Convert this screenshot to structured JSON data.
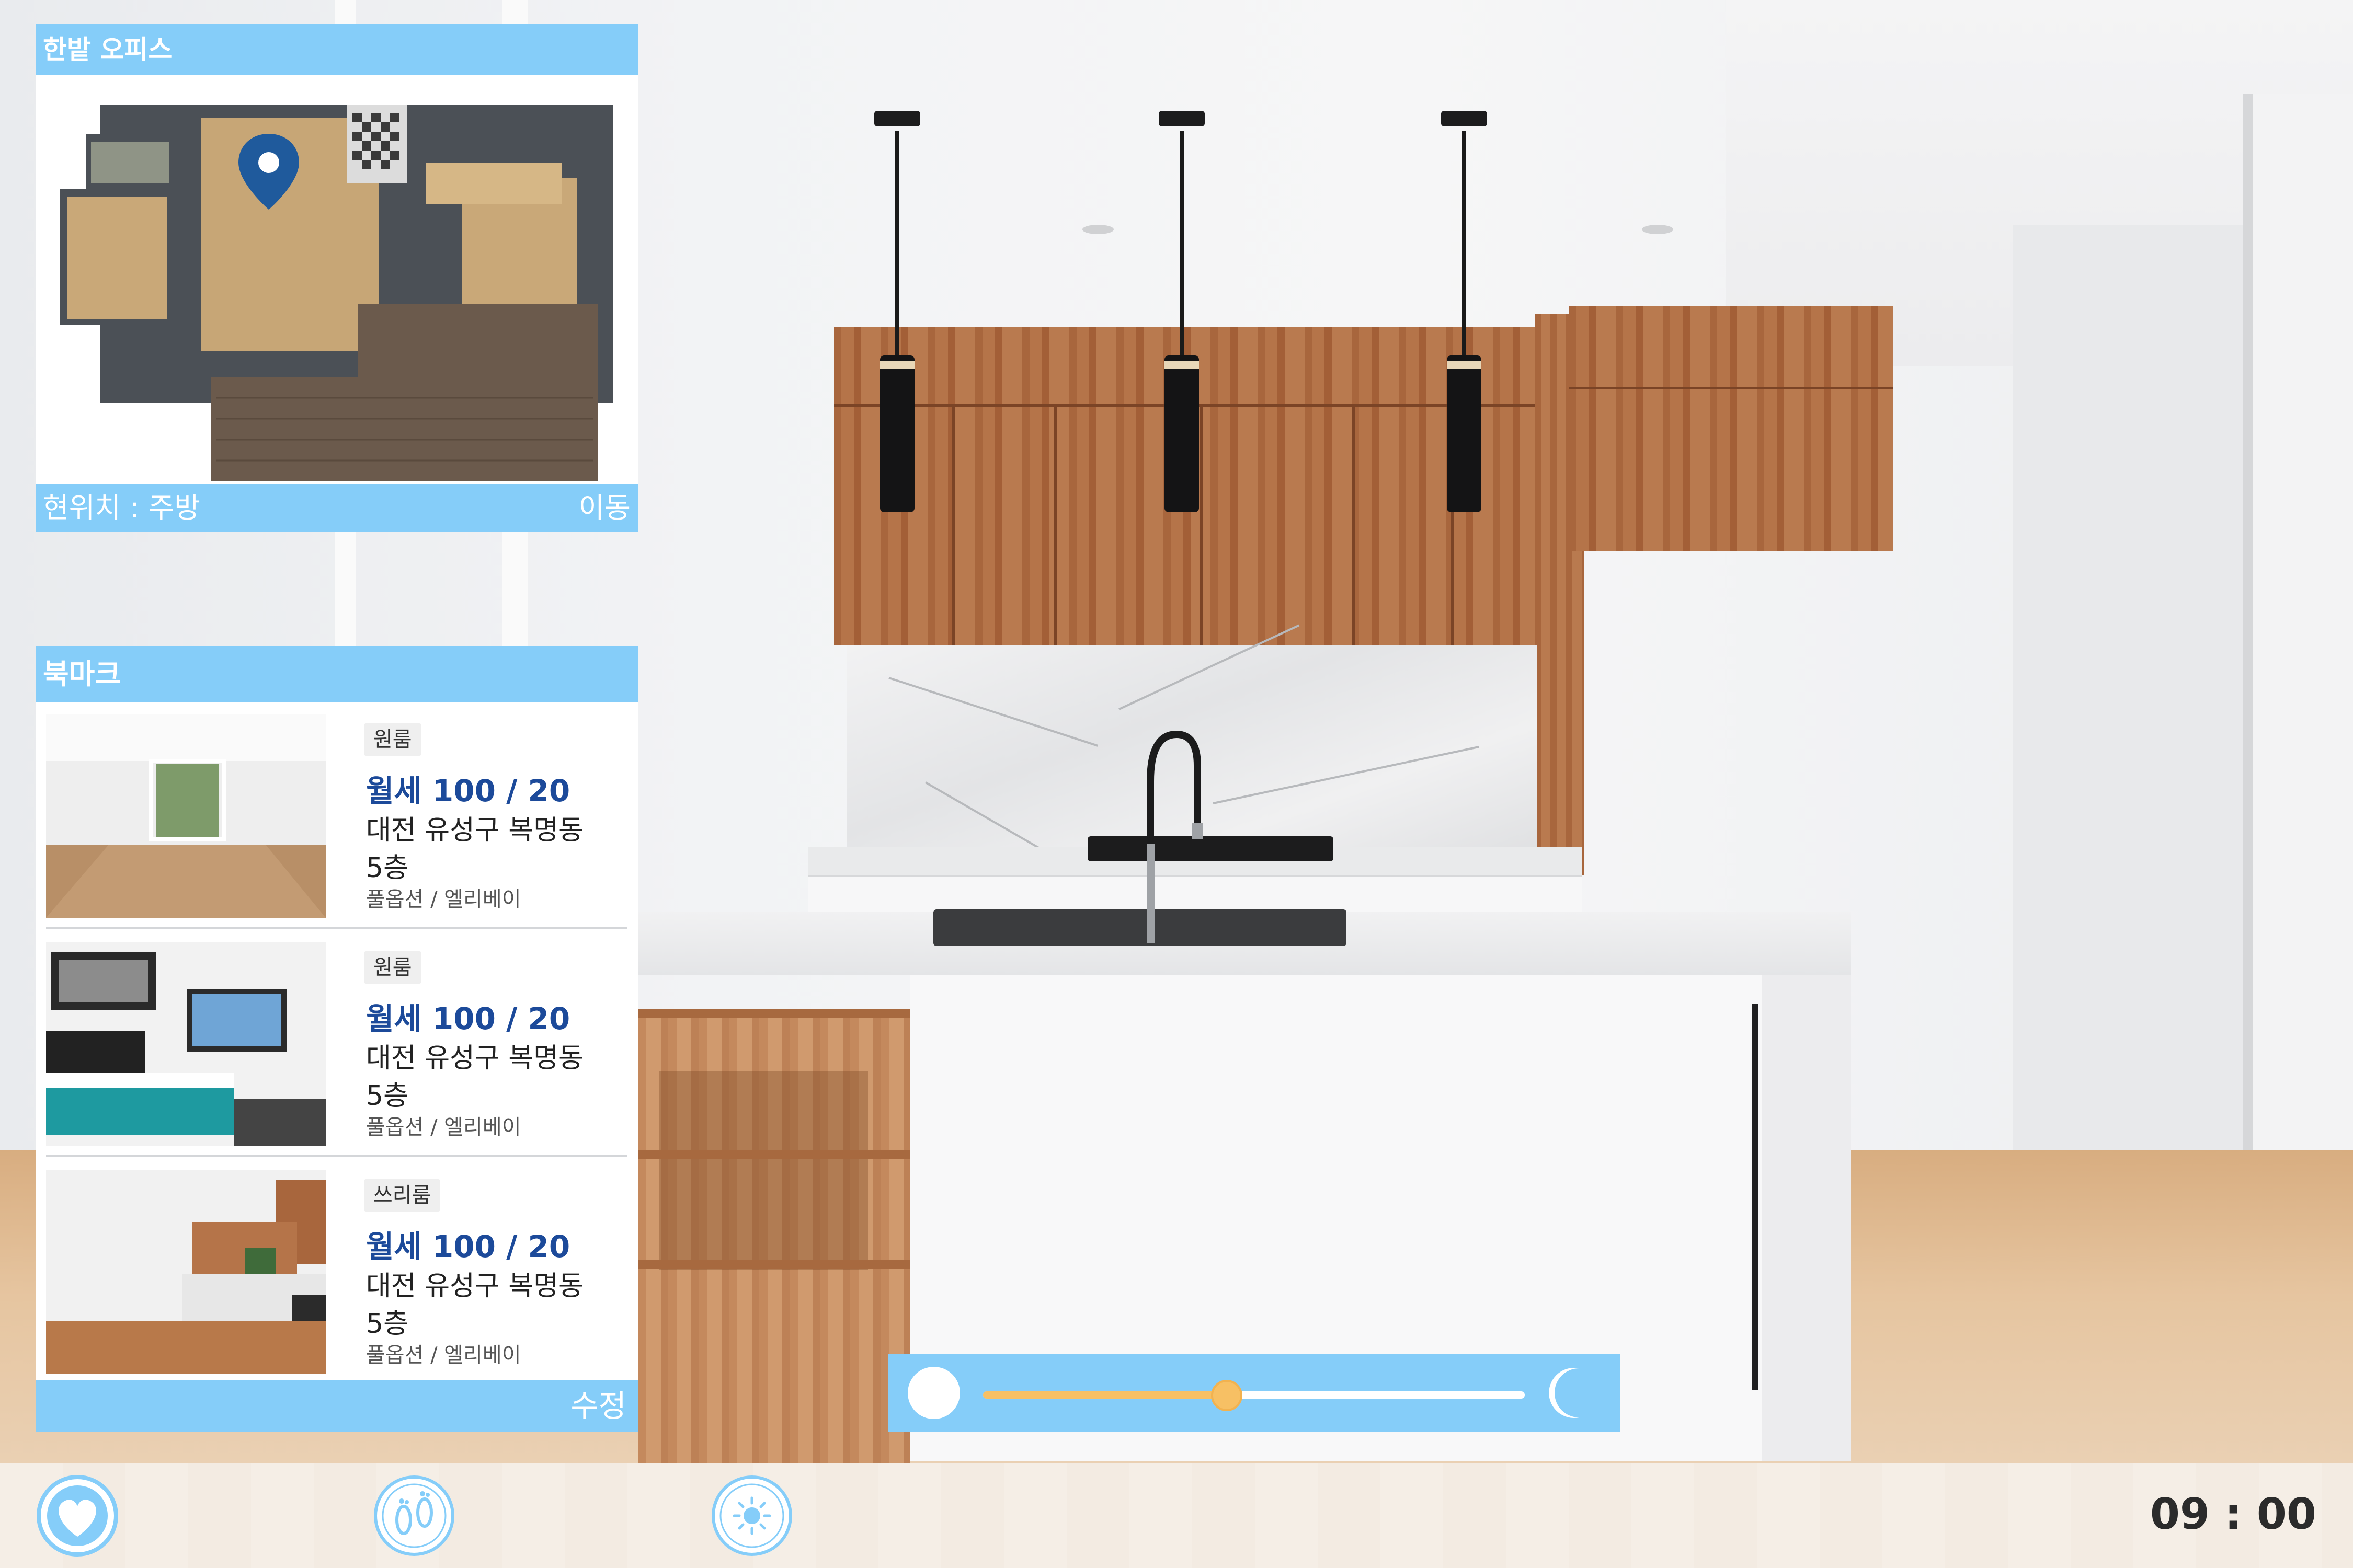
{
  "map_panel": {
    "title": "한밭 오피스",
    "current_location": "현위치 : 주방",
    "move_label": "이동"
  },
  "bookmark_panel": {
    "title": "북마크",
    "edit_label": "수정",
    "items": [
      {
        "room_type": "원룸",
        "price": "월세 100 / 20",
        "address": "대전 유성구 복명동",
        "floor": "5층",
        "options": "풀옵션 / 엘리베이"
      },
      {
        "room_type": "원룸",
        "price": "월세 100 / 20",
        "address": "대전 유성구 복명동",
        "floor": "5층",
        "options": "풀옵션 / 엘리베이"
      },
      {
        "room_type": "쓰리룸",
        "price": "월세 100 / 20",
        "address": "대전 유성구 복명동",
        "floor": "5층",
        "options": "풀옵션 / 엘리베이"
      }
    ]
  },
  "time_slider": {
    "value_fraction": 0.45,
    "start_icon": "sun-icon",
    "end_icon": "moon-icon"
  },
  "bottom_bar": {
    "buttons": [
      {
        "icon": "heart-icon"
      },
      {
        "icon": "footprints-icon"
      },
      {
        "icon": "brightness-icon"
      }
    ],
    "clock": "09 : 00"
  },
  "colors": {
    "accent": "#85cdf9",
    "price_text": "#1c4a9a",
    "slider_fill": "#f7c064",
    "pin": "#1f5a9c"
  }
}
